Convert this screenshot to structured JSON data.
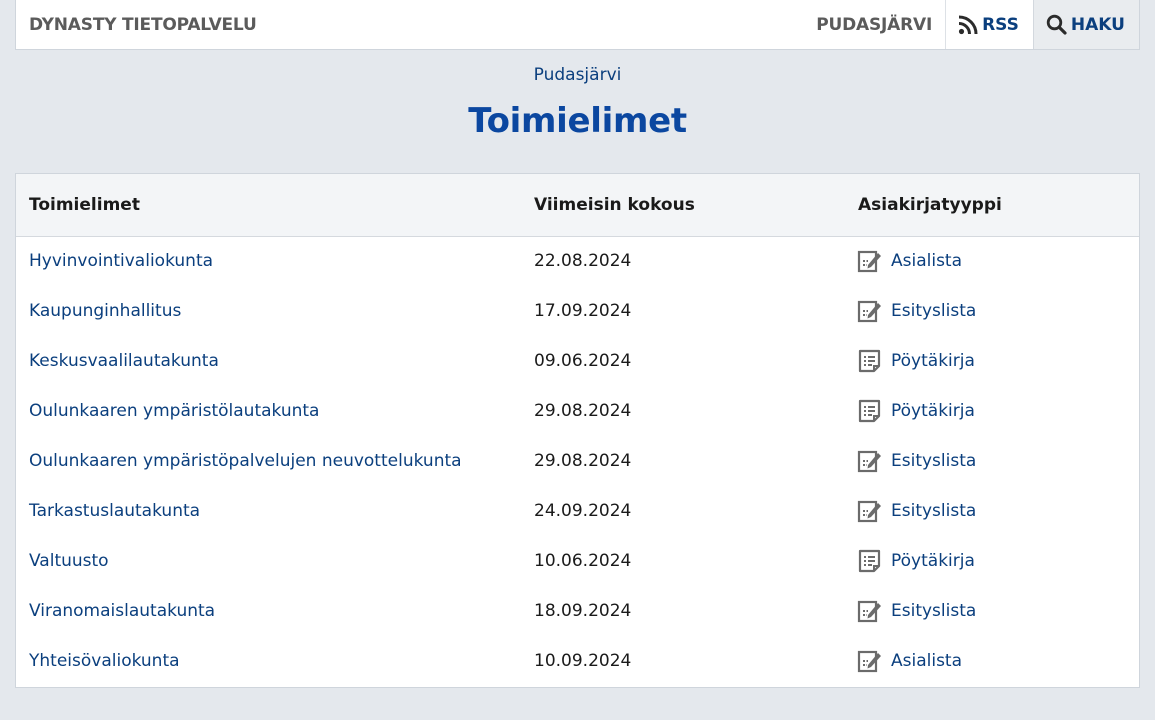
{
  "header": {
    "brand": "DYNASTY TIETOPALVELU",
    "municipality": "PUDASJÄRVI",
    "rss_label": "RSS",
    "search_label": "HAKU"
  },
  "breadcrumb": "Pudasjärvi",
  "page_title": "Toimielimet",
  "table": {
    "columns": [
      "Toimielimet",
      "Viimeisin kokous",
      "Asiakirjatyyppi"
    ],
    "rows": [
      {
        "name": "Hyvinvointivaliokunta",
        "date": "22.08.2024",
        "doctype": "Asialista",
        "icon": "agenda-edit-icon"
      },
      {
        "name": "Kaupunginhallitus",
        "date": "17.09.2024",
        "doctype": "Esityslista",
        "icon": "agenda-edit-icon"
      },
      {
        "name": "Keskusvaalilautakunta",
        "date": "09.06.2024",
        "doctype": "Pöytäkirja",
        "icon": "minutes-list-icon"
      },
      {
        "name": "Oulunkaaren ympäristölautakunta",
        "date": "29.08.2024",
        "doctype": "Pöytäkirja",
        "icon": "minutes-list-icon"
      },
      {
        "name": "Oulunkaaren ympäristöpalvelujen neuvottelukunta",
        "date": "29.08.2024",
        "doctype": "Esityslista",
        "icon": "agenda-edit-icon"
      },
      {
        "name": "Tarkastuslautakunta",
        "date": "24.09.2024",
        "doctype": "Esityslista",
        "icon": "agenda-edit-icon"
      },
      {
        "name": "Valtuusto",
        "date": "10.06.2024",
        "doctype": "Pöytäkirja",
        "icon": "minutes-list-icon"
      },
      {
        "name": "Viranomaislautakunta",
        "date": "18.09.2024",
        "doctype": "Esityslista",
        "icon": "agenda-edit-icon"
      },
      {
        "name": "Yhteisövaliokunta",
        "date": "10.09.2024",
        "doctype": "Asialista",
        "icon": "agenda-edit-icon"
      }
    ]
  },
  "colors": {
    "link": "#0b3f7e",
    "title": "#0b47a0",
    "background": "#e4e8ed",
    "icon": "#6b6b6b"
  }
}
